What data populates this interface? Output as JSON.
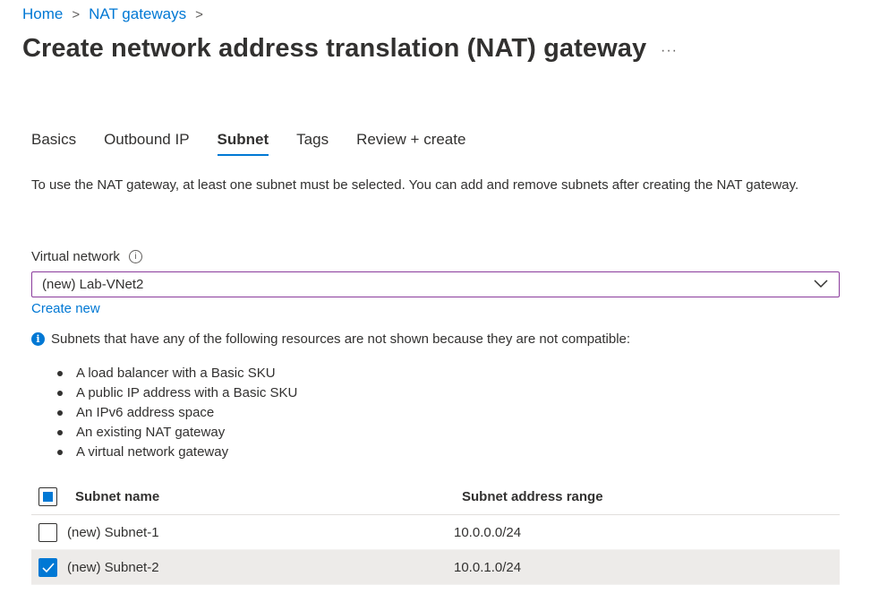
{
  "breadcrumb": {
    "home": "Home",
    "parent": "NAT gateways"
  },
  "page": {
    "title": "Create network address translation (NAT) gateway",
    "more": "···"
  },
  "tabs": [
    {
      "label": "Basics",
      "active": false
    },
    {
      "label": "Outbound IP",
      "active": false
    },
    {
      "label": "Subnet",
      "active": true
    },
    {
      "label": "Tags",
      "active": false
    },
    {
      "label": "Review + create",
      "active": false
    }
  ],
  "intro": "To use the NAT gateway, at least one subnet must be selected. You can add and remove subnets after creating the NAT gateway.",
  "virtual_network": {
    "label": "Virtual network",
    "value": "(new) Lab-VNet2",
    "create_new": "Create new"
  },
  "notice": {
    "text": "Subnets that have any of the following resources are not shown because they are not compatible:",
    "items": [
      "A load balancer with a Basic SKU",
      "A public IP address with a Basic SKU",
      "An IPv6 address space",
      "An existing NAT gateway",
      "A virtual network gateway"
    ]
  },
  "table": {
    "columns": [
      "Subnet name",
      "Subnet address range"
    ],
    "rows": [
      {
        "name": "(new) Subnet-1",
        "range": "10.0.0.0/24",
        "checked": false
      },
      {
        "name": "(new) Subnet-2",
        "range": "10.0.1.0/24",
        "checked": true
      }
    ]
  },
  "colors": {
    "accent": "#0078d4",
    "select_border": "#8a3b9c",
    "selected_row": "#edebe9"
  }
}
